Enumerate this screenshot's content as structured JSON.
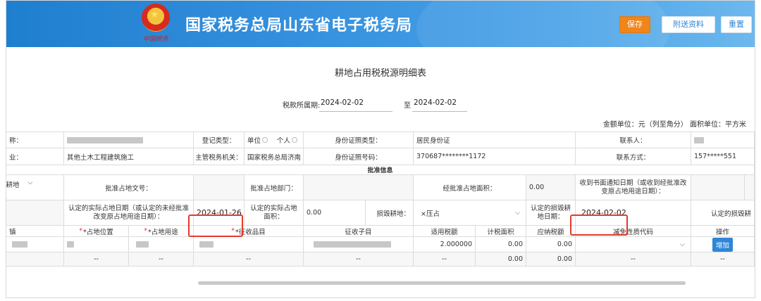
{
  "header": {
    "emblem_text": "中国税务",
    "title": "国家税务总局山东省电子税务局",
    "save_label": "保存",
    "attach_label": "附送资料",
    "reset_label": "重置",
    "colors": {
      "save": "#f08519",
      "header": "#2a88d8",
      "highlight": "#e23b2e"
    }
  },
  "page": {
    "title": "耕地占用税税源明细表",
    "period_label": "税款所属期:",
    "period_start": "2024-02-02",
    "period_to": "至",
    "period_end": "2024-02-02",
    "units": "金额单位：元（列至角分） 面积单位：平方米"
  },
  "info": {
    "name_label": "称：",
    "industry_label": "业：",
    "industry_value": "其他土木工程建筑施工",
    "reg_type_label": "登记类型：",
    "reg_option_unit": "单位",
    "reg_option_person": "个人",
    "tax_authority_label": "主管税务机关：",
    "tax_authority_value": "国家税务总局济南",
    "id_type_label": "身份证照类型：",
    "id_type_value": "居民身份证",
    "id_no_label": "身份证照号码：",
    "id_no_value": "370687********1172",
    "contact_label": "联系人：",
    "phone_label": "联系方式：",
    "phone_value": "157*****551"
  },
  "approval": {
    "section_title": "批准信息",
    "land_type_value": "总耕地",
    "doc_no_label": "批准占地文号：",
    "dept_label": "批准占地部门：",
    "area_label": "经批准占地面积：",
    "area_value": "0.00",
    "notice_date_label": "收到书面通知日期（或收到经批准改变原占地用途日期）：",
    "actual_date_label": "认定的实际占地日期（或认定的未经批准改变原占地用途日期）：",
    "actual_date_value": "2024-01-26",
    "actual_area_label": "认定的实际占地面积：",
    "actual_area_value": "0.00",
    "damage_label": "损毁耕地：",
    "damage_value": "×压占",
    "damage_date_label": "认定的损毁耕地日期：",
    "damage_date_value": "2024-02-02",
    "damage_more_label": "认定的损毁耕"
  },
  "detail": {
    "columns": [
      "镇",
      "*占地位置",
      "*占地用途",
      "*征收品目",
      "征收子目",
      "适用税额",
      "计税面积",
      "应纳税额",
      "减免性质代码",
      "操作"
    ],
    "row1": {
      "tax_rate": "2.000000",
      "taxable_area": "0.00",
      "tax_due": "0.00",
      "add_label": "增加"
    },
    "total_row": {
      "dash": "--",
      "tax_rate": "--",
      "taxable_area": "0.00",
      "tax_due": "0.00"
    }
  }
}
